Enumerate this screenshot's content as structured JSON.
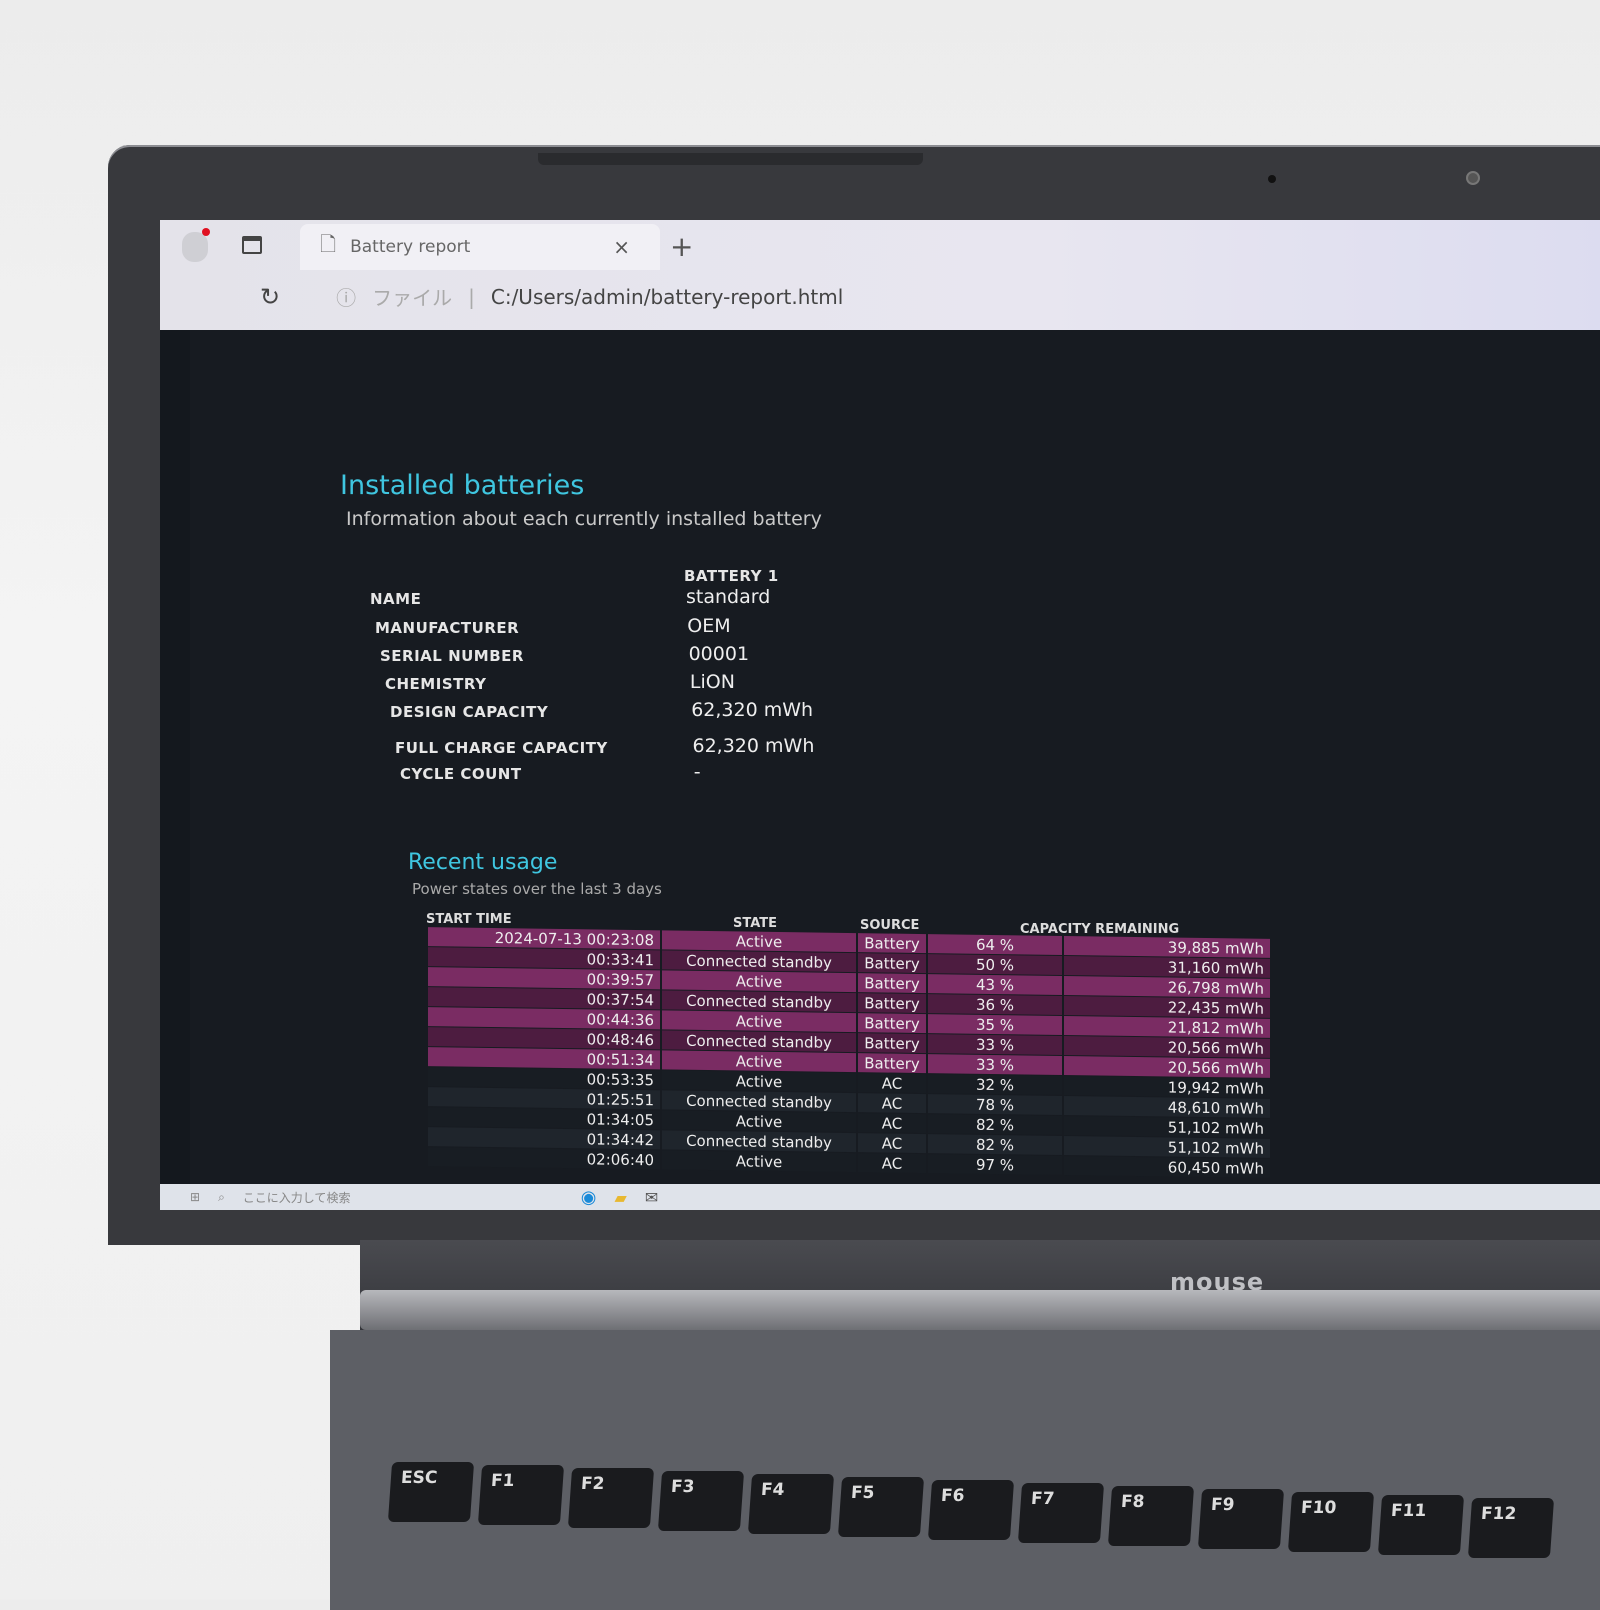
{
  "browser": {
    "tab_title": "Battery report",
    "close": "×",
    "new_tab": "+",
    "reload": "↻",
    "info": "ⓘ",
    "file_label": "ファイル",
    "url": "C:/Users/admin/battery-report.html"
  },
  "installed": {
    "title": "Installed batteries",
    "subtitle": "Information about each currently installed battery",
    "column": "BATTERY 1",
    "rows": [
      {
        "label": "NAME",
        "value": "standard"
      },
      {
        "label": "MANUFACTURER",
        "value": "OEM"
      },
      {
        "label": "SERIAL NUMBER",
        "value": "00001"
      },
      {
        "label": "CHEMISTRY",
        "value": "LiON"
      },
      {
        "label": "DESIGN CAPACITY",
        "value": "62,320 mWh"
      },
      {
        "label": "FULL CHARGE CAPACITY",
        "value": "62,320 mWh"
      },
      {
        "label": "CYCLE COUNT",
        "value": "-"
      }
    ]
  },
  "recent": {
    "title": "Recent usage",
    "subtitle": "Power states over the last 3 days",
    "headers": {
      "start": "START TIME",
      "state": "STATE",
      "source": "SOURCE",
      "capacity": "CAPACITY REMAINING"
    },
    "rows": [
      {
        "time": "2024-07-13  00:23:08",
        "state": "Active",
        "source": "Battery",
        "pct": "64 %",
        "mwh": "39,885 mWh"
      },
      {
        "time": "00:33:41",
        "state": "Connected standby",
        "source": "Battery",
        "pct": "50 %",
        "mwh": "31,160 mWh"
      },
      {
        "time": "00:39:57",
        "state": "Active",
        "source": "Battery",
        "pct": "43 %",
        "mwh": "26,798 mWh"
      },
      {
        "time": "00:37:54",
        "state": "Connected standby",
        "source": "Battery",
        "pct": "36 %",
        "mwh": "22,435 mWh"
      },
      {
        "time": "00:44:36",
        "state": "Active",
        "source": "Battery",
        "pct": "35 %",
        "mwh": "21,812 mWh"
      },
      {
        "time": "00:48:46",
        "state": "Connected standby",
        "source": "Battery",
        "pct": "33 %",
        "mwh": "20,566 mWh"
      },
      {
        "time": "00:51:34",
        "state": "Active",
        "source": "Battery",
        "pct": "33 %",
        "mwh": "20,566 mWh"
      },
      {
        "time": "00:53:35",
        "state": "Active",
        "source": "AC",
        "pct": "32 %",
        "mwh": "19,942 mWh"
      },
      {
        "time": "01:25:51",
        "state": "Connected standby",
        "source": "AC",
        "pct": "78 %",
        "mwh": "48,610 mWh"
      },
      {
        "time": "01:34:05",
        "state": "Active",
        "source": "AC",
        "pct": "82 %",
        "mwh": "51,102 mWh"
      },
      {
        "time": "01:34:42",
        "state": "Connected standby",
        "source": "AC",
        "pct": "82 %",
        "mwh": "51,102 mWh"
      },
      {
        "time": "02:06:40",
        "state": "Active",
        "source": "AC",
        "pct": "97 %",
        "mwh": "60,450 mWh"
      }
    ]
  },
  "taskbar": {
    "start": "⊞",
    "search": "ここに入力して検索"
  },
  "laptop": {
    "brand": "mouse",
    "keys": [
      "ESC",
      "F1",
      "F2",
      "F3",
      "F4",
      "F5",
      "F6",
      "F7",
      "F8",
      "F9",
      "F10",
      "F11",
      "F12"
    ]
  },
  "colors": {
    "accent": "#3fc6e0",
    "battery_row": "#7a2c63",
    "background": "#171b21"
  }
}
